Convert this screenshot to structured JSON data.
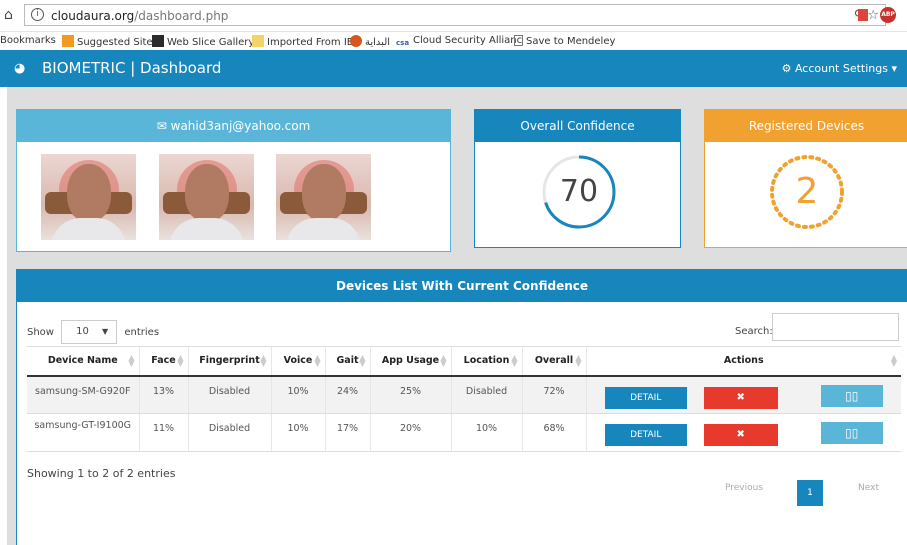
{
  "browser": {
    "url_host": "cloudaura.org",
    "url_path": "/dashboard.php",
    "bookmarks": [
      "Bookmarks",
      "Suggested Sites",
      "Web Slice Gallery",
      "Imported From IE",
      "البداية",
      "Cloud Security Allianc",
      "Save to Mendeley"
    ]
  },
  "navbar": {
    "brand": "BIOMETRIC | Dashboard",
    "account": "Account Settings"
  },
  "user_panel": {
    "email": "wahid3anj@yahoo.com"
  },
  "confidence_panel": {
    "title": "Overall Confidence",
    "value": "70",
    "progress": 0.7
  },
  "devices_panel": {
    "title": "Registered Devices",
    "value": "2"
  },
  "list": {
    "title": "Devices List With Current Confidence",
    "show_label": "Show",
    "show_value": "10",
    "entries_label": "entries",
    "search_label": "Search:",
    "columns": [
      "Device Name",
      "Face",
      "Fingerprint",
      "Voice",
      "Gait",
      "App Usage",
      "Location",
      "Overall",
      "Actions"
    ],
    "rows": [
      {
        "device": "samsung-SM-G920F",
        "face": "13%",
        "fingerprint": "Disabled",
        "voice": "10%",
        "gait": "24%",
        "app": "25%",
        "location": "Disabled",
        "overall": "72%"
      },
      {
        "device": "samsung-GT-I9100G",
        "face": "11%",
        "fingerprint": "Disabled",
        "voice": "10%",
        "gait": "17%",
        "app": "20%",
        "location": "10%",
        "overall": "68%"
      }
    ],
    "detail_label": "DETAIL",
    "info": "Showing 1 to 2 of 2 entries",
    "prev": "Previous",
    "page": "1",
    "next": "Next"
  },
  "colors": {
    "primary": "#1686bd",
    "light_blue": "#5ab6d8",
    "orange": "#f0a130",
    "danger": "#e8392d"
  }
}
